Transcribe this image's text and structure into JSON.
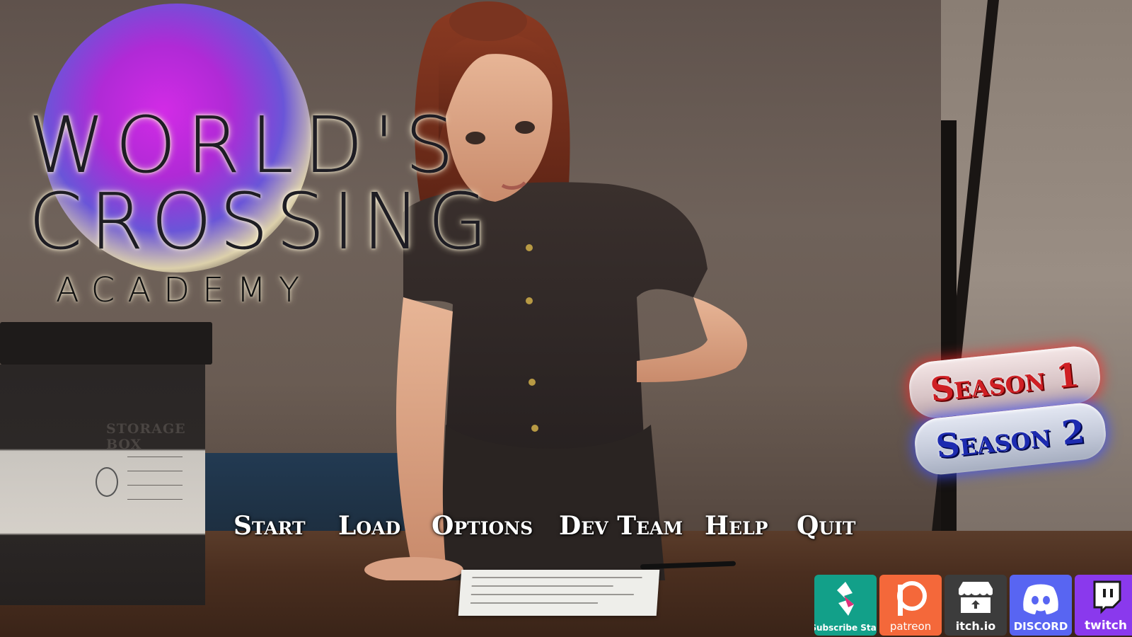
{
  "logo": {
    "line1": "WORLD'S",
    "line2": "CROSSING",
    "line3": "ACADEMY"
  },
  "menu": {
    "start": "Start",
    "load": "Load",
    "options": "Options",
    "dev_team": "Dev Team",
    "help": "Help",
    "quit": "Quit"
  },
  "seasons": {
    "season1": "Season 1",
    "season2": "Season 2"
  },
  "scene": {
    "storage_box_label": "STORAGE BOX"
  },
  "social": {
    "subscribestar": "Subscribe Star",
    "patreon": "patreon",
    "itchio": "itch.io",
    "discord": "DISCORD",
    "twitch": "twitch"
  },
  "colors": {
    "season1_accent": "#cf1f24",
    "season2_accent": "#1d2bb0",
    "logo_orb": "#d22be6",
    "subscribestar": "#12a089",
    "patreon": "#f4683a",
    "itchio": "#3c3c3c",
    "discord": "#5865f2",
    "twitch": "#8a39ed"
  }
}
